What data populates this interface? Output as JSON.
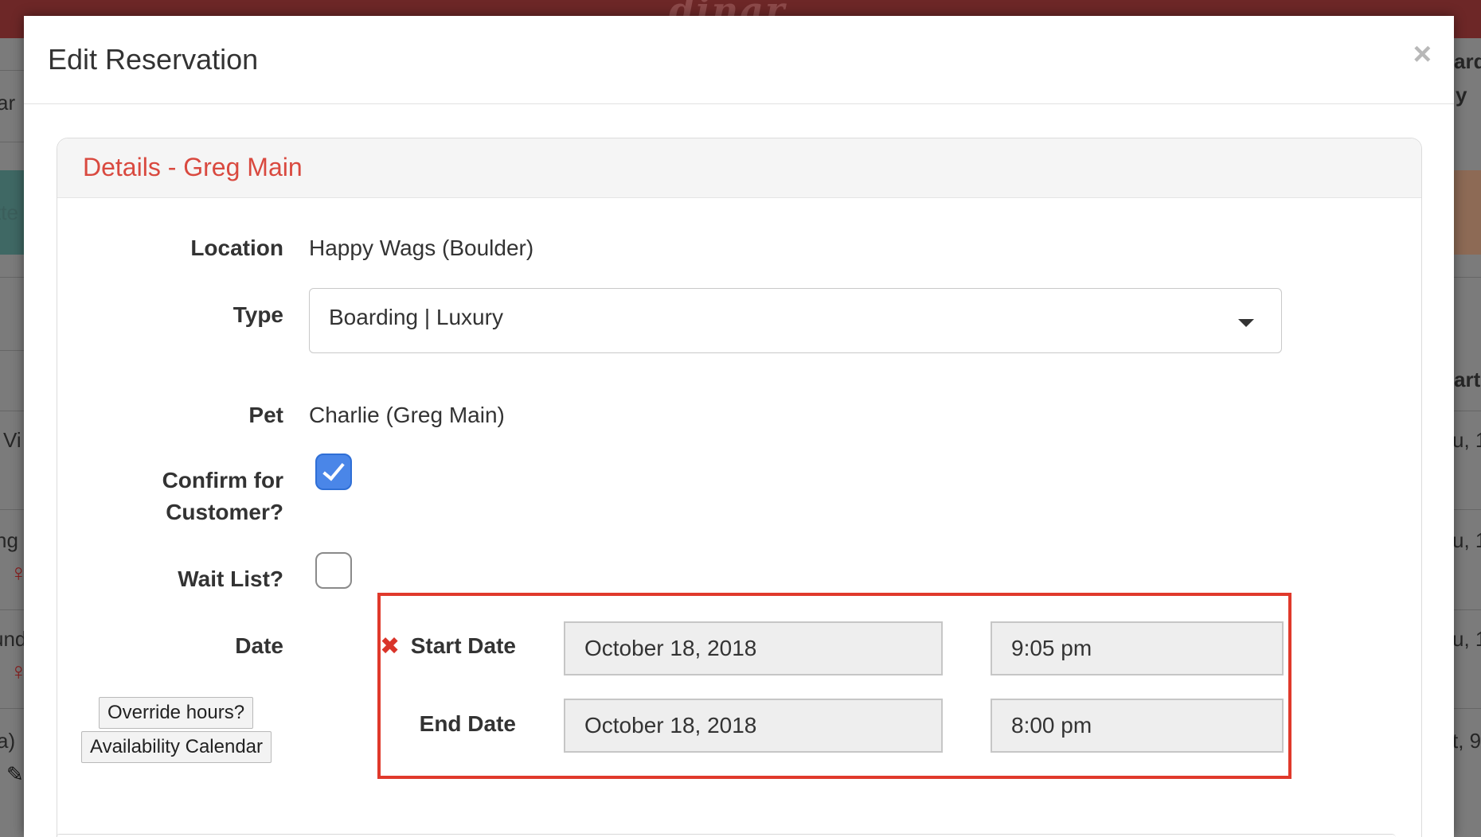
{
  "background": {
    "logo": "dinar",
    "left_fragments": [
      "ar",
      "tte",
      "Vi",
      "ng",
      "und",
      "a)"
    ],
    "right_fragments": [
      "ard",
      "y",
      "art",
      "u, 1",
      "u, 1",
      "u, 1",
      "t, 9"
    ]
  },
  "modal": {
    "title": "Edit Reservation",
    "close_symbol": "×"
  },
  "panel": {
    "title": "Details - Greg Main"
  },
  "form": {
    "location_label": "Location",
    "location_value": "Happy Wags (Boulder)",
    "type_label": "Type",
    "type_value": "Boarding | Luxury",
    "pet_label": "Pet",
    "pet_value": "Charlie (Greg Main)",
    "confirm_label_line1": "Confirm for",
    "confirm_label_line2": "Customer?",
    "confirm_checked": true,
    "waitlist_label": "Wait List?",
    "waitlist_checked": false,
    "date_label": "Date",
    "override_button": "Override hours?",
    "availability_button": "Availability Calendar",
    "error_symbol": "✖",
    "start_date_label": "Start Date",
    "start_date_value": "October 18, 2018",
    "start_time_value": "9:05 pm",
    "end_date_label": "End Date",
    "end_date_value": "October 18, 2018",
    "end_time_value": "8:00 pm"
  },
  "colors": {
    "accent_red": "#d9493f",
    "highlight_border": "#e0392b",
    "checkbox_blue": "#4a86e8",
    "topbar": "#6d2727"
  }
}
